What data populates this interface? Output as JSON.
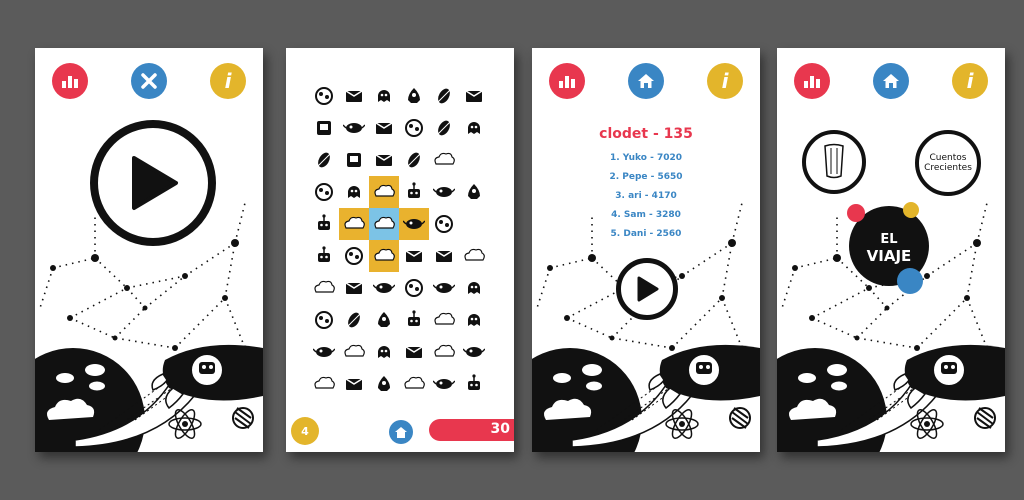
{
  "colors": {
    "red": "#e8374e",
    "blue": "#3a86c4",
    "yellow": "#e3b52b",
    "black": "#111111",
    "puzzle_blue": "#7cc3e6",
    "puzzle_yellow": "#e9b22e"
  },
  "screen1": {
    "icons": [
      "ranking-icon",
      "close-icon",
      "info-icon"
    ],
    "info_label": "i"
  },
  "screen2": {
    "level": "4",
    "score": "30",
    "icons": [
      "home-icon"
    ]
  },
  "screen3": {
    "title": "clodet - 135",
    "ranking": [
      "1. Yuko - 7020",
      "2. Pepe - 5650",
      "3. ari - 4170",
      "4. Sam - 3280",
      "5. Dani - 2560"
    ],
    "info_label": "i"
  },
  "screen4": {
    "info_label": "i",
    "promo_left_label": "",
    "promo_right_label": "Cuentos Crecientes",
    "promo_right_line1": "Cuentos",
    "promo_right_line2": "Crecientes",
    "app_line1": "EL",
    "app_line2": "VIAJE"
  }
}
